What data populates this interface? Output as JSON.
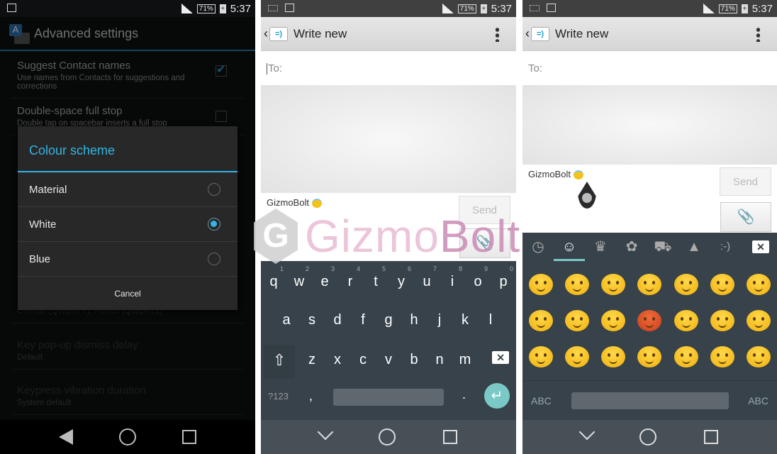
{
  "status": {
    "time": "5:37",
    "battery": "71%",
    "charging": "+"
  },
  "settings": {
    "title": "Advanced settings",
    "items": [
      {
        "title": "Suggest Contact names",
        "summary": "Use names from Contacts for suggestions and corrections",
        "checked": true
      },
      {
        "title": "Double-space full stop",
        "summary": "Double tap on spacebar inserts a full stop",
        "checked": false
      },
      {
        "title": "",
        "summary": "German (QWERTY), French (QWERTZ)"
      },
      {
        "title": "Key pop-up dismiss delay",
        "summary": "Default"
      },
      {
        "title": "Keypress vibration duration",
        "summary": "System default"
      }
    ],
    "dialog": {
      "title": "Colour scheme",
      "options": [
        {
          "label": "Material",
          "selected": false
        },
        {
          "label": "White",
          "selected": true
        },
        {
          "label": "Blue",
          "selected": false
        }
      ],
      "cancel": "Cancel",
      "accent": "#33b5e5"
    }
  },
  "compose": {
    "title": "Write new",
    "to_placeholder": "To:",
    "message": "GizmoBolt",
    "send": "Send"
  },
  "keyboard": {
    "row1": [
      [
        "q",
        "1"
      ],
      [
        "w",
        "2"
      ],
      [
        "e",
        "3"
      ],
      [
        "r",
        "4"
      ],
      [
        "t",
        "5"
      ],
      [
        "y",
        "6"
      ],
      [
        "u",
        "7"
      ],
      [
        "i",
        "8"
      ],
      [
        "o",
        "9"
      ],
      [
        "p",
        "0"
      ]
    ],
    "row2": [
      "a",
      "s",
      "d",
      "f",
      "g",
      "h",
      "j",
      "k",
      "l"
    ],
    "row3": [
      "z",
      "x",
      "c",
      "v",
      "b",
      "n",
      "m"
    ],
    "symbols": "?123",
    "comma": ",",
    "period": ".",
    "color": "#37424a",
    "enter_color": "#7ac9c6"
  },
  "emoji": {
    "tabs": [
      "recents-icon",
      "smiley-icon",
      "crown-icon",
      "flower-icon",
      "car-icon",
      "triangle-icon",
      ":-)"
    ],
    "active_tab": 1,
    "faces": [
      "smile",
      "blush",
      "grin",
      "grin-big",
      "grin-sweat",
      "slight-smile",
      "tongue",
      "laugh",
      "wink-smile",
      "innocent",
      "imp",
      "wink",
      "confused",
      "neutral",
      "expressionless",
      "unamused",
      "angry",
      "grimace",
      "persevere",
      "disappointed",
      "sleepy"
    ],
    "abc": "ABC"
  },
  "watermark": {
    "text1": "Gizmo",
    "text2": "Bolt"
  }
}
